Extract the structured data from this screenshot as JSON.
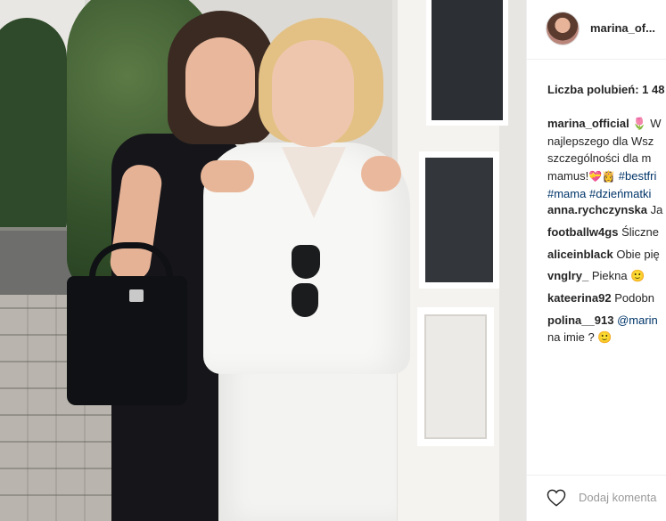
{
  "post": {
    "username": "marina_of...",
    "likes_text": "Liczba polubień: 1 48"
  },
  "caption": {
    "username": "marina_official",
    "text_line1": "🌷 W",
    "text_line2": "najlepszego dla Wsz",
    "text_line3": "szczególności dla m",
    "text_line4_prefix": "mamus!",
    "text_line4_emoji": "💝👸",
    "text_line4_tag": "#bestfri",
    "tag_mama": "#mama",
    "tag_dzien": "#dzieńmatki"
  },
  "comments": [
    {
      "username": "anna.rychczynska",
      "text": "Ja"
    },
    {
      "username": "footballw4gs",
      "text": "Śliczne"
    },
    {
      "username": "aliceinblack",
      "text": "Obie pię"
    },
    {
      "username": "vnglry_",
      "text": "Piekna 🙂"
    },
    {
      "username": "kateerina92",
      "text": "Podobn"
    },
    {
      "username": "polina__913",
      "mention": "@marin",
      "text_line2": "na imie ? 🙂"
    }
  ],
  "footer": {
    "add_comment_placeholder": "Dodaj komenta"
  },
  "icons": {
    "like": "heart-icon"
  },
  "colors": {
    "link": "#003569",
    "text": "#262626",
    "muted": "#999999"
  }
}
